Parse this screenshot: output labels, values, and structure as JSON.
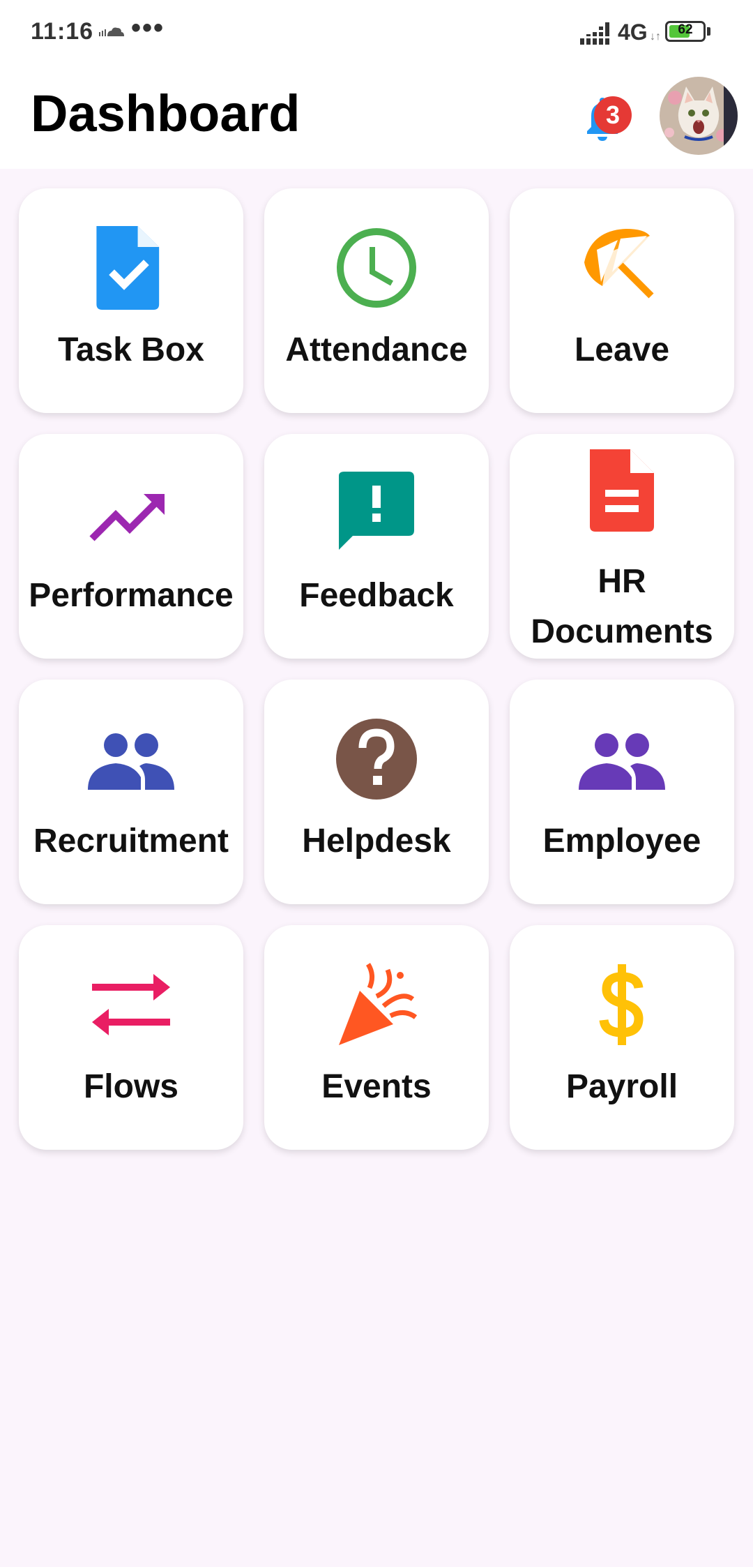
{
  "status_bar": {
    "time": "11:16",
    "more_indicator": "•••",
    "network": "4G",
    "network_arrows": "↓↑",
    "battery": "62",
    "battery_level": 0.62
  },
  "header": {
    "title": "Dashboard",
    "notification_count": "3"
  },
  "tiles": [
    {
      "label": "Task Box",
      "icon": "task-check-icon",
      "color": "#2196F3"
    },
    {
      "label": "Attendance",
      "icon": "clock-icon",
      "color": "#4CAF50"
    },
    {
      "label": "Leave",
      "icon": "beach-umbrella-icon",
      "color": "#FF9800"
    },
    {
      "label": "Performance",
      "icon": "trending-up-icon",
      "color": "#9C27B0"
    },
    {
      "label": "Feedback",
      "icon": "feedback-icon",
      "color": "#009688"
    },
    {
      "label": "HR Documents",
      "icon": "document-icon",
      "color": "#F44336"
    },
    {
      "label": "Recruitment",
      "icon": "people-icon",
      "color": "#3F51B5"
    },
    {
      "label": "Helpdesk",
      "icon": "help-icon",
      "color": "#795548"
    },
    {
      "label": "Employee",
      "icon": "people-icon",
      "color": "#673AB7"
    },
    {
      "label": "Flows",
      "icon": "swap-arrows-icon",
      "color": "#E91E63"
    },
    {
      "label": "Events",
      "icon": "celebration-icon",
      "color": "#FF5722"
    },
    {
      "label": "Payroll",
      "icon": "dollar-icon",
      "color": "#FFC107"
    }
  ]
}
